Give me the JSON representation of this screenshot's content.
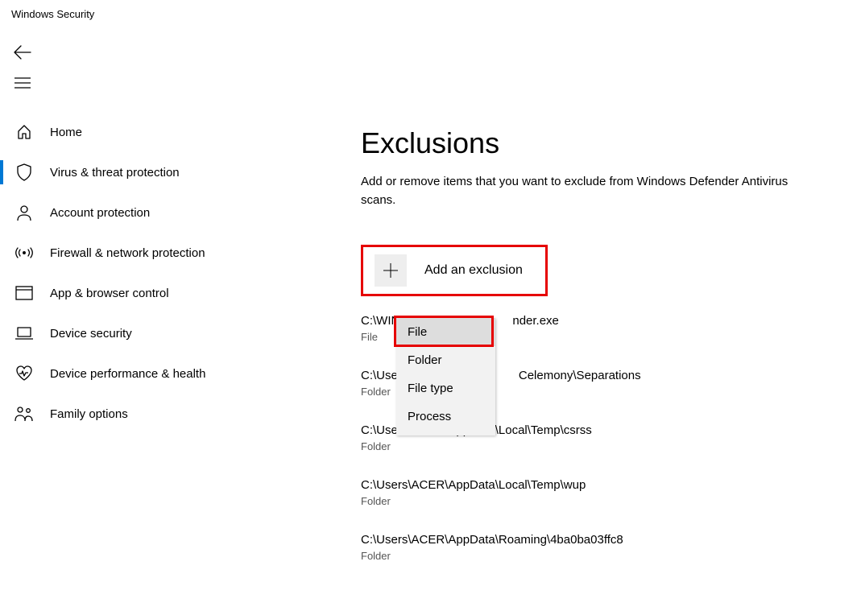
{
  "app_title": "Windows Security",
  "page": {
    "title": "Exclusions",
    "subtitle": "Add or remove items that you want to exclude from Windows Defender Antivirus scans."
  },
  "add_button": {
    "label": "Add an exclusion"
  },
  "menu": {
    "items": [
      {
        "label": "File"
      },
      {
        "label": "Folder"
      },
      {
        "label": "File type"
      },
      {
        "label": "Process"
      }
    ]
  },
  "nav": [
    {
      "label": "Home",
      "icon": "home-icon",
      "active": false
    },
    {
      "label": "Virus & threat protection",
      "icon": "shield-icon",
      "active": true
    },
    {
      "label": "Account protection",
      "icon": "person-icon",
      "active": false
    },
    {
      "label": "Firewall & network protection",
      "icon": "antenna-icon",
      "active": false
    },
    {
      "label": "App & browser control",
      "icon": "window-icon",
      "active": false
    },
    {
      "label": "Device security",
      "icon": "laptop-icon",
      "active": false
    },
    {
      "label": "Device performance & health",
      "icon": "heart-icon",
      "active": false
    },
    {
      "label": "Family options",
      "icon": "family-icon",
      "active": false
    }
  ],
  "exclusions": [
    {
      "path": "C:\\WIND                               nder.exe",
      "type": "File"
    },
    {
      "path": "C:\\Users\\                                Celemony\\Separations",
      "type": "Folder"
    },
    {
      "path": "C:\\Users\\ACER\\AppData\\Local\\Temp\\csrss",
      "type": "Folder"
    },
    {
      "path": "C:\\Users\\ACER\\AppData\\Local\\Temp\\wup",
      "type": "Folder"
    },
    {
      "path": "C:\\Users\\ACER\\AppData\\Roaming\\4ba0ba03ffc8",
      "type": "Folder"
    }
  ]
}
